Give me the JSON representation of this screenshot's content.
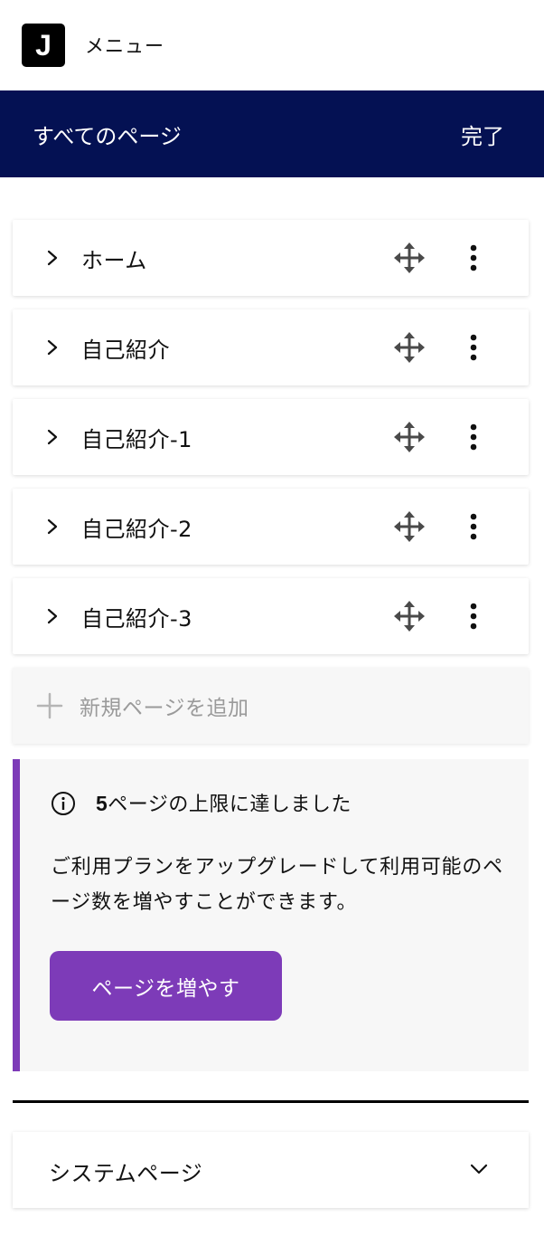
{
  "topbar": {
    "logo_letter": "J",
    "menu_label": "メニュー"
  },
  "pages_header": {
    "title": "すべてのページ",
    "done_label": "完了"
  },
  "pages": [
    {
      "name": "ホーム"
    },
    {
      "name": "自己紹介"
    },
    {
      "name": "自己紹介-1"
    },
    {
      "name": "自己紹介-2"
    },
    {
      "name": "自己紹介-3"
    }
  ],
  "add_page": {
    "label": "新規ページを追加"
  },
  "limit_notice": {
    "count": "5",
    "title_rest": "ページの上限に達しました",
    "description": "ご利用プランをアップグレードして利用可能のページ数を増やすことができます。",
    "button_label": "ページを増やす"
  },
  "system_pages": {
    "label": "システムページ"
  },
  "icons": {
    "chevron": "chevron-right-icon",
    "move": "move-icon",
    "more": "more-vertical-icon",
    "plus": "plus-icon",
    "info": "info-icon",
    "expand": "chevron-down-icon"
  },
  "colors": {
    "header_bg": "#041153",
    "accent": "#7d3bb8",
    "muted_text": "#9a9a9a",
    "notice_bg": "#f7f7f7"
  }
}
